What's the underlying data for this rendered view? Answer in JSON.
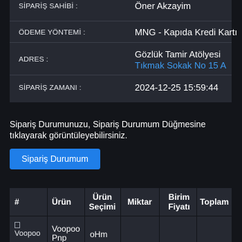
{
  "order_info": {
    "owner_label": "SİPARİŞ SAHİBİ :",
    "owner_value": "Öner Akzayim",
    "payment_label": "ÖDEME YÖNTEMİ :",
    "payment_value": "MNG - Kapıda Kredi Kartı",
    "address_label": "ADRES :",
    "address_line1": "Gözlük Tamir Atölyesi",
    "address_line2": "Tıkmak Sokak No 15 A",
    "time_label": "SİPARİŞ ZAMANI :",
    "time_value": "2024-12-25 15:59:44"
  },
  "note": "Sipariş Durumunuzu, Sipariş Durumum Düğmesine tıklayarak görüntüleyebilirsiniz.",
  "status_button_label": "Sipariş Durumum",
  "table": {
    "headers": {
      "index": "#",
      "product": "Ürün",
      "product_selection": "Ürün Seçimi",
      "quantity": "Miktar",
      "unit_price": "Birim Fiyatı",
      "total": "Toplam"
    },
    "rows": [
      {
        "image_alt": "Voopoo",
        "product": "Voopoo Pnp",
        "selection": "oHm"
      }
    ]
  }
}
